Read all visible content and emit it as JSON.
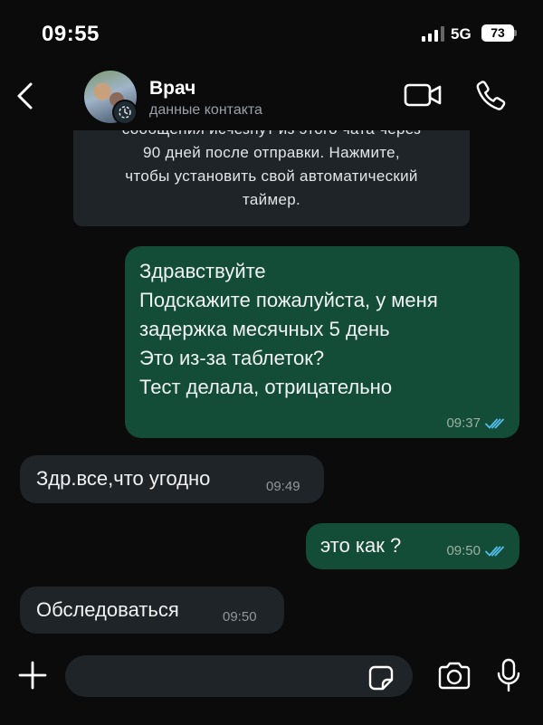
{
  "status_bar": {
    "time": "09:55",
    "network": "5G",
    "battery": "73"
  },
  "header": {
    "name": "Врач",
    "subtitle": "данные контакта"
  },
  "notice": {
    "lines": [
      "сообщения исчезнут из этого чата через",
      "90 дней после отправки. Нажмите,",
      "чтобы установить свой автоматический",
      "таймер."
    ]
  },
  "messages": [
    {
      "direction": "out",
      "text": "Здравствуйте\nПодскажите пожалуйста, у меня\nзадержка месячных 5 день\nЭто из-за таблеток?\nТест делала, отрицательно",
      "time": "09:37",
      "read": true
    },
    {
      "direction": "in",
      "text": "Здр.все,что угодно",
      "time": "09:49"
    },
    {
      "direction": "out",
      "text": "это как ?",
      "time": "09:50",
      "read": true
    },
    {
      "direction": "in",
      "text": "Обследоваться",
      "time": "09:50"
    }
  ],
  "input": {
    "placeholder": ""
  },
  "colors": {
    "outgoing": "#144d37",
    "incoming": "#1f2428",
    "read_ticks": "#53bdeb",
    "background": "#0b0b0b"
  }
}
